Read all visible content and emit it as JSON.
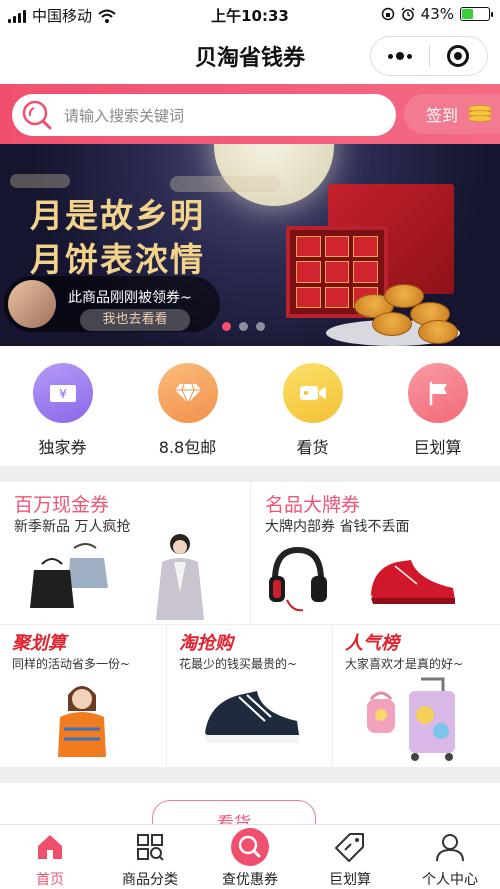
{
  "status_bar": {
    "carrier": "中国移动",
    "time": "上午10:33",
    "battery_percent": "43%",
    "battery_level": 0.43
  },
  "header": {
    "title": "贝淘省钱券",
    "more_icon": "more-dots-icon",
    "close_icon": "target-close-icon"
  },
  "search": {
    "placeholder": "请输入搜索关键词",
    "signin_label": "签到"
  },
  "banner": {
    "headline_line1": "月是故乡明",
    "headline_line2": "月饼表浓情",
    "toast_message": "此商品刚刚被领券~",
    "toast_action": "我也去看看",
    "pages": 3,
    "active_page": 1
  },
  "quick_entries": [
    {
      "label": "独家券",
      "icon": "coupon-icon",
      "color": "#9b7cf0"
    },
    {
      "label": "8.8包邮",
      "icon": "diamond-icon",
      "color": "#f6a05a"
    },
    {
      "label": "看货",
      "icon": "video-icon",
      "color": "#f6cf45"
    },
    {
      "label": "巨划算",
      "icon": "flag-icon",
      "color": "#f47a86"
    }
  ],
  "promos_top": [
    {
      "title": "百万现金券",
      "subtitle": "新季新品 万人疯抢"
    },
    {
      "title": "名品大牌券",
      "subtitle": "大牌内部券 省钱不丢面"
    }
  ],
  "promos_bottom": [
    {
      "title": "聚划算",
      "subtitle": "同样的活动省多一份~"
    },
    {
      "title": "淘抢购",
      "subtitle": "花最少的钱买最贵的~"
    },
    {
      "title": "人气榜",
      "subtitle": "大家喜欢才是真的好~"
    }
  ],
  "section": {
    "label": "看货"
  },
  "tabbar": {
    "items": [
      {
        "label": "首页",
        "icon": "home-icon",
        "active": true
      },
      {
        "label": "商品分类",
        "icon": "category-grid-icon",
        "active": false
      },
      {
        "label": "查优惠券",
        "icon": "search-coupon-icon",
        "active": false
      },
      {
        "label": "巨划算",
        "icon": "price-tag-icon",
        "active": false
      },
      {
        "label": "个人中心",
        "icon": "user-icon",
        "active": false
      }
    ]
  },
  "colors": {
    "accent": "#f05575",
    "search_band": "#f0506e"
  }
}
